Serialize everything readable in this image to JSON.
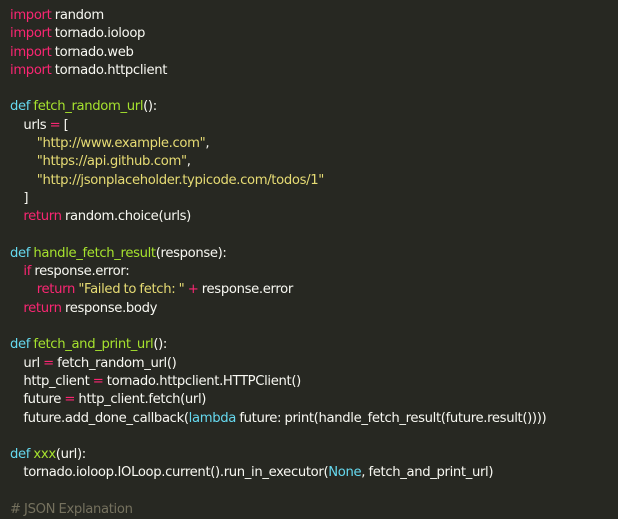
{
  "colors": {
    "background": "#272822",
    "keyword": "#f92672",
    "def": "#66d9ef",
    "function": "#a6e22e",
    "string": "#e6db74",
    "comment": "#75715e",
    "text": "#f8f8f2"
  },
  "editor": {
    "lines": [
      [
        {
          "t": "import",
          "k": "keyword"
        },
        {
          "t": " random",
          "k": "plain"
        }
      ],
      [
        {
          "t": "import",
          "k": "keyword"
        },
        {
          "t": " tornado",
          "k": "plain"
        },
        {
          "t": ".",
          "k": "punct"
        },
        {
          "t": "ioloop",
          "k": "plain"
        }
      ],
      [
        {
          "t": "import",
          "k": "keyword"
        },
        {
          "t": " tornado",
          "k": "plain"
        },
        {
          "t": ".",
          "k": "punct"
        },
        {
          "t": "web",
          "k": "plain"
        }
      ],
      [
        {
          "t": "import",
          "k": "keyword"
        },
        {
          "t": " tornado",
          "k": "plain"
        },
        {
          "t": ".",
          "k": "punct"
        },
        {
          "t": "httpclient",
          "k": "plain"
        }
      ],
      [],
      [
        {
          "t": "def",
          "k": "def"
        },
        {
          "t": " ",
          "k": "plain"
        },
        {
          "t": "fetch_random_url",
          "k": "func"
        },
        {
          "t": "():",
          "k": "punct"
        }
      ],
      [
        {
          "t": "    urls ",
          "k": "plain"
        },
        {
          "t": "=",
          "k": "op"
        },
        {
          "t": " [",
          "k": "punct"
        }
      ],
      [
        {
          "t": "        ",
          "k": "plain"
        },
        {
          "t": "\"http://www.example.com\"",
          "k": "string"
        },
        {
          "t": ",",
          "k": "punct"
        }
      ],
      [
        {
          "t": "        ",
          "k": "plain"
        },
        {
          "t": "\"https://api.github.com\"",
          "k": "string"
        },
        {
          "t": ",",
          "k": "punct"
        }
      ],
      [
        {
          "t": "        ",
          "k": "plain"
        },
        {
          "t": "\"http://jsonplaceholder.typicode.com/todos/1\"",
          "k": "string"
        }
      ],
      [
        {
          "t": "    ]",
          "k": "punct"
        }
      ],
      [
        {
          "t": "    ",
          "k": "plain"
        },
        {
          "t": "return",
          "k": "keyword"
        },
        {
          "t": " random",
          "k": "plain"
        },
        {
          "t": ".",
          "k": "punct"
        },
        {
          "t": "choice(urls)",
          "k": "plain"
        }
      ],
      [],
      [
        {
          "t": "def",
          "k": "def"
        },
        {
          "t": " ",
          "k": "plain"
        },
        {
          "t": "handle_fetch_result",
          "k": "func"
        },
        {
          "t": "(response):",
          "k": "punct"
        }
      ],
      [
        {
          "t": "    ",
          "k": "plain"
        },
        {
          "t": "if",
          "k": "keyword"
        },
        {
          "t": " response",
          "k": "plain"
        },
        {
          "t": ".",
          "k": "punct"
        },
        {
          "t": "error:",
          "k": "plain"
        }
      ],
      [
        {
          "t": "        ",
          "k": "plain"
        },
        {
          "t": "return",
          "k": "keyword"
        },
        {
          "t": " ",
          "k": "plain"
        },
        {
          "t": "\"Failed to fetch: \"",
          "k": "string"
        },
        {
          "t": " ",
          "k": "plain"
        },
        {
          "t": "+",
          "k": "op"
        },
        {
          "t": " response",
          "k": "plain"
        },
        {
          "t": ".",
          "k": "punct"
        },
        {
          "t": "error",
          "k": "plain"
        }
      ],
      [
        {
          "t": "    ",
          "k": "plain"
        },
        {
          "t": "return",
          "k": "keyword"
        },
        {
          "t": " response",
          "k": "plain"
        },
        {
          "t": ".",
          "k": "punct"
        },
        {
          "t": "body",
          "k": "plain"
        }
      ],
      [],
      [
        {
          "t": "def",
          "k": "def"
        },
        {
          "t": " ",
          "k": "plain"
        },
        {
          "t": "fetch_and_print_url",
          "k": "func"
        },
        {
          "t": "():",
          "k": "punct"
        }
      ],
      [
        {
          "t": "    url ",
          "k": "plain"
        },
        {
          "t": "=",
          "k": "op"
        },
        {
          "t": " fetch_random_url()",
          "k": "plain"
        }
      ],
      [
        {
          "t": "    http_client ",
          "k": "plain"
        },
        {
          "t": "=",
          "k": "op"
        },
        {
          "t": " tornado",
          "k": "plain"
        },
        {
          "t": ".",
          "k": "punct"
        },
        {
          "t": "httpclient",
          "k": "plain"
        },
        {
          "t": ".",
          "k": "punct"
        },
        {
          "t": "HTTPClient()",
          "k": "plain"
        }
      ],
      [
        {
          "t": "    future ",
          "k": "plain"
        },
        {
          "t": "=",
          "k": "op"
        },
        {
          "t": " http_client",
          "k": "plain"
        },
        {
          "t": ".",
          "k": "punct"
        },
        {
          "t": "fetch(url)",
          "k": "plain"
        }
      ],
      [
        {
          "t": "    future",
          "k": "plain"
        },
        {
          "t": ".",
          "k": "punct"
        },
        {
          "t": "add_done_callback(",
          "k": "plain"
        },
        {
          "t": "lambda",
          "k": "def"
        },
        {
          "t": " future: print(handle_fetch_result(future",
          "k": "plain"
        },
        {
          "t": ".",
          "k": "punct"
        },
        {
          "t": "result())))",
          "k": "plain"
        }
      ],
      [],
      [
        {
          "t": "def",
          "k": "def"
        },
        {
          "t": " ",
          "k": "plain"
        },
        {
          "t": "xxx",
          "k": "func"
        },
        {
          "t": "(url):",
          "k": "punct"
        }
      ],
      [
        {
          "t": "    tornado",
          "k": "plain"
        },
        {
          "t": ".",
          "k": "punct"
        },
        {
          "t": "ioloop",
          "k": "plain"
        },
        {
          "t": ".",
          "k": "punct"
        },
        {
          "t": "IOLoop",
          "k": "plain"
        },
        {
          "t": ".",
          "k": "punct"
        },
        {
          "t": "current()",
          "k": "plain"
        },
        {
          "t": ".",
          "k": "punct"
        },
        {
          "t": "run_in_executor(",
          "k": "plain"
        },
        {
          "t": "None",
          "k": "const"
        },
        {
          "t": ", fetch_and_print_url)",
          "k": "plain"
        }
      ],
      [],
      [
        {
          "t": "# JSON Explanation",
          "k": "comment"
        }
      ]
    ]
  }
}
